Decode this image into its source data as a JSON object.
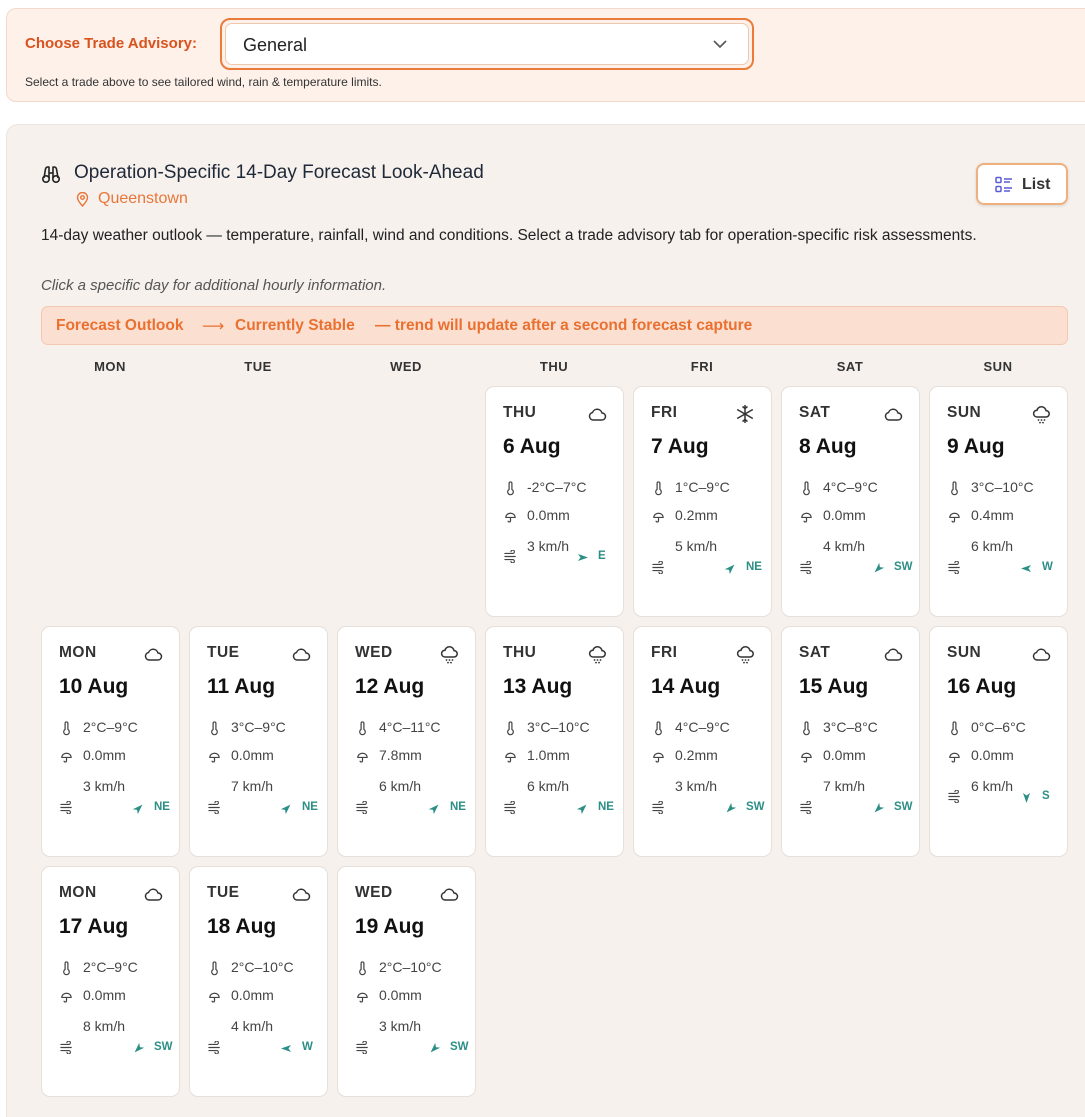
{
  "advisory": {
    "label": "Choose Trade Advisory:",
    "selected": "General",
    "hint": "Select a trade above to see tailored wind, rain & temperature limits."
  },
  "forecast": {
    "title": "Operation-Specific 14-Day Forecast Look-Ahead",
    "location": "Queenstown",
    "list_button": "List",
    "description": "14-day weather outlook — temperature, rainfall, wind and conditions. Select a trade advisory tab for operation-specific risk assessments.",
    "click_hint": "Click a specific day for additional hourly information.",
    "trend": {
      "label": "Forecast Outlook",
      "arrow": "⟶",
      "status": "Currently Stable",
      "note": "— trend will update after a second forecast capture"
    },
    "weekday_headers": [
      "MON",
      "TUE",
      "WED",
      "THU",
      "FRI",
      "SAT",
      "SUN"
    ],
    "days": [
      {
        "dow": "THU",
        "date": "6 Aug",
        "temp": "-2°C–7°C",
        "rain": "0.0mm",
        "wind": "3 km/h",
        "dir": "E",
        "icon": "cloud-icon"
      },
      {
        "dow": "FRI",
        "date": "7 Aug",
        "temp": "1°C–9°C",
        "rain": "0.2mm",
        "wind": "5 km/h",
        "dir": "NE",
        "icon": "snowflake-icon"
      },
      {
        "dow": "SAT",
        "date": "8 Aug",
        "temp": "4°C–9°C",
        "rain": "0.0mm",
        "wind": "4 km/h",
        "dir": "SW",
        "icon": "cloud-icon"
      },
      {
        "dow": "SUN",
        "date": "9 Aug",
        "temp": "3°C–10°C",
        "rain": "0.4mm",
        "wind": "6 km/h",
        "dir": "W",
        "icon": "rain-cloud-icon"
      },
      {
        "dow": "MON",
        "date": "10 Aug",
        "temp": "2°C–9°C",
        "rain": "0.0mm",
        "wind": "3 km/h",
        "dir": "NE",
        "icon": "cloud-icon"
      },
      {
        "dow": "TUE",
        "date": "11 Aug",
        "temp": "3°C–9°C",
        "rain": "0.0mm",
        "wind": "7 km/h",
        "dir": "NE",
        "icon": "cloud-icon"
      },
      {
        "dow": "WED",
        "date": "12 Aug",
        "temp": "4°C–11°C",
        "rain": "7.8mm",
        "wind": "6 km/h",
        "dir": "NE",
        "icon": "rain-cloud-icon"
      },
      {
        "dow": "THU",
        "date": "13 Aug",
        "temp": "3°C–10°C",
        "rain": "1.0mm",
        "wind": "6 km/h",
        "dir": "NE",
        "icon": "rain-cloud-icon"
      },
      {
        "dow": "FRI",
        "date": "14 Aug",
        "temp": "4°C–9°C",
        "rain": "0.2mm",
        "wind": "3 km/h",
        "dir": "SW",
        "icon": "rain-cloud-icon"
      },
      {
        "dow": "SAT",
        "date": "15 Aug",
        "temp": "3°C–8°C",
        "rain": "0.0mm",
        "wind": "7 km/h",
        "dir": "SW",
        "icon": "cloud-icon"
      },
      {
        "dow": "SUN",
        "date": "16 Aug",
        "temp": "0°C–6°C",
        "rain": "0.0mm",
        "wind": "6 km/h",
        "dir": "S",
        "icon": "cloud-icon"
      },
      {
        "dow": "MON",
        "date": "17 Aug",
        "temp": "2°C–9°C",
        "rain": "0.0mm",
        "wind": "8 km/h",
        "dir": "SW",
        "icon": "cloud-icon"
      },
      {
        "dow": "TUE",
        "date": "18 Aug",
        "temp": "2°C–10°C",
        "rain": "0.0mm",
        "wind": "4 km/h",
        "dir": "W",
        "icon": "cloud-icon"
      },
      {
        "dow": "WED",
        "date": "19 Aug",
        "temp": "2°C–10°C",
        "rain": "0.0mm",
        "wind": "3 km/h",
        "dir": "SW",
        "icon": "cloud-icon"
      }
    ]
  },
  "colors": {
    "accent": "#e8763a",
    "wind_direction": "#2c8f86",
    "trend_background": "#fbe0d2"
  }
}
